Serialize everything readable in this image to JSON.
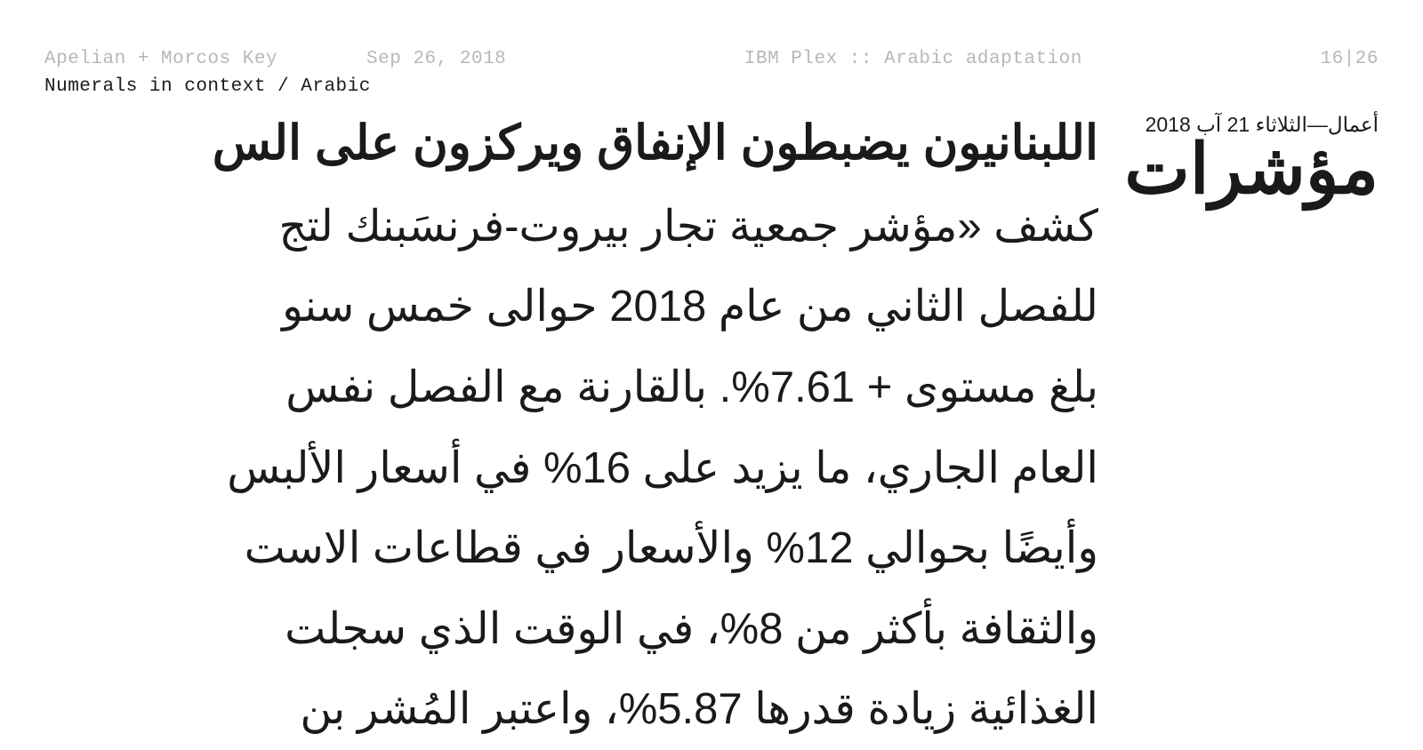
{
  "header": {
    "author": "Apelian + Morcos Key",
    "date": "Sep 26, 2018",
    "project": "IBM Plex :: Arabic adaptation",
    "page": "16|26"
  },
  "subtitle": "Numerals in context / Arabic",
  "sidebar": {
    "date": "أعمال—الثلاثاء 21 آب 2018",
    "label": "مؤشرات"
  },
  "body": {
    "headline": "اللبنانيون يضبطون الإنفاق ويركزون على الس",
    "lines": [
      "كشف «مؤشر جمعية تجار بيروت-فرنسَبنك لتج",
      "للفصل الثاني من عام 2018 حوالى خمس سنو",
      "بلغ مستوى + 7.61%. بالقارنة مع الفصل نفس",
      "العام الجاري، ما يزيد على 16% في أسعار الألبس",
      "وأيضًا بحوالي 12% والأسعار في قطاعات الاست",
      "والثقافة بأكثر من 8%، في الوقت الذي سجلت",
      "الغذائية زيادة قدرها 5.87%، واعتبر المُشر بن"
    ]
  }
}
